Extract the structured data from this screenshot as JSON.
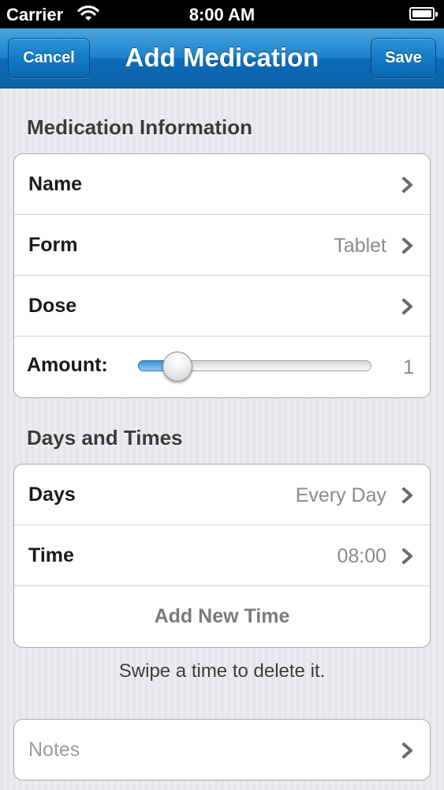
{
  "status_bar": {
    "carrier": "Carrier",
    "time": "8:00 AM",
    "wifi_icon": "wifi-icon",
    "battery_icon": "battery-icon"
  },
  "nav": {
    "title": "Add Medication",
    "cancel_label": "Cancel",
    "save_label": "Save",
    "accent_color": "#1d83cb"
  },
  "medication_info": {
    "header": "Medication Information",
    "name_label": "Name",
    "form_label": "Form",
    "form_value": "Tablet",
    "dose_label": "Dose",
    "amount_label": "Amount:",
    "amount_value": "1",
    "amount_slider_fraction": 0.17
  },
  "days_times": {
    "header": "Days and Times",
    "days_label": "Days",
    "days_value": "Every Day",
    "time_label": "Time",
    "time_value": "08:00",
    "add_time_label": "Add New Time",
    "footer": "Swipe a time to delete it."
  },
  "notes": {
    "placeholder": "Notes"
  },
  "icons": {
    "chevron": "chevron-right-icon"
  }
}
